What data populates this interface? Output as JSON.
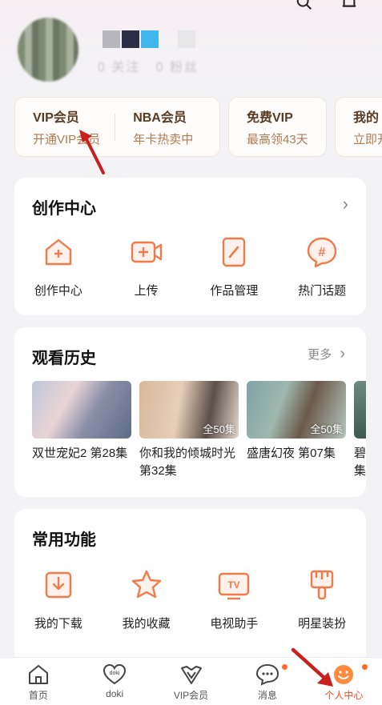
{
  "vip_cards": [
    {
      "title": "VIP会员",
      "subtitle": "开通VIP会员"
    },
    {
      "title": "NBA会员",
      "subtitle": "年卡热卖中"
    },
    {
      "title": "免费VIP",
      "subtitle": "最高领43天"
    },
    {
      "title": "我的",
      "subtitle": "立即开"
    }
  ],
  "creation": {
    "title": "创作中心",
    "items": [
      {
        "label": "创作中心",
        "icon": "home-plus-icon"
      },
      {
        "label": "上传",
        "icon": "video-upload-icon"
      },
      {
        "label": "作品管理",
        "icon": "edit-icon"
      },
      {
        "label": "热门话题",
        "icon": "hashtag-icon"
      }
    ]
  },
  "history": {
    "title": "观看历史",
    "more": "更多",
    "items": [
      {
        "caption": "双世宠妃2 第28集",
        "badge": ""
      },
      {
        "caption": "你和我的倾城时光 第32集",
        "badge": "全50集"
      },
      {
        "caption": "盛唐幻夜 第07集",
        "badge": "全50集"
      },
      {
        "caption": "碧集",
        "badge": ""
      }
    ]
  },
  "tools": {
    "title": "常用功能",
    "items": [
      {
        "label": "我的下载",
        "icon": "download-icon"
      },
      {
        "label": "我的收藏",
        "icon": "star-icon"
      },
      {
        "label": "电视助手",
        "icon": "tv-icon"
      },
      {
        "label": "明星装扮",
        "icon": "paint-brush-icon"
      }
    ]
  },
  "tabbar": [
    {
      "label": "首页",
      "icon": "home-icon"
    },
    {
      "label": "doki",
      "icon": "doki-heart-icon"
    },
    {
      "label": "VIP会员",
      "icon": "vip-crown-icon"
    },
    {
      "label": "消息",
      "icon": "message-icon"
    },
    {
      "label": "个人中心",
      "icon": "smile-face-icon"
    }
  ],
  "colors": {
    "accent": "#ff4a22",
    "icon_orange": "#f07a4a",
    "vip_brown": "#5a3a22"
  }
}
